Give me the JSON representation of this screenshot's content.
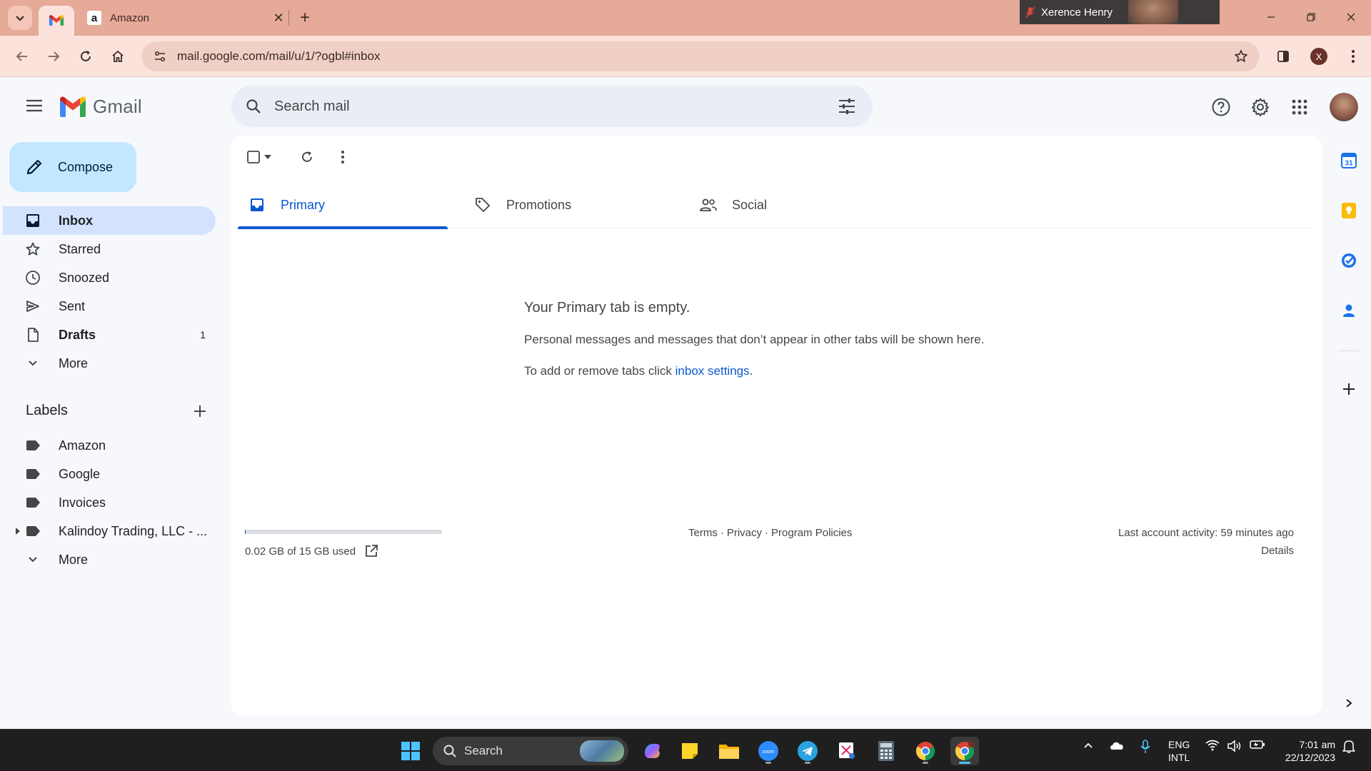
{
  "browser": {
    "tabs": [
      {
        "title": "",
        "favicon": "gmail-icon",
        "active": true
      },
      {
        "title": "Amazon",
        "favicon": "amazon-icon",
        "active": false
      }
    ],
    "video_overlay": {
      "name": "Xerence Henry"
    },
    "url": "mail.google.com/mail/u/1/?ogbl#inbox",
    "profile_initial": "X"
  },
  "gmail": {
    "logo_text": "Gmail",
    "search": {
      "placeholder": "Search mail"
    },
    "compose_label": "Compose",
    "nav": [
      {
        "label": "Inbox",
        "icon": "inbox-icon",
        "active": true,
        "bold": true,
        "count": ""
      },
      {
        "label": "Starred",
        "icon": "star-icon",
        "active": false,
        "bold": false,
        "count": ""
      },
      {
        "label": "Snoozed",
        "icon": "clock-icon",
        "active": false,
        "bold": false,
        "count": ""
      },
      {
        "label": "Sent",
        "icon": "send-icon",
        "active": false,
        "bold": false,
        "count": ""
      },
      {
        "label": "Drafts",
        "icon": "draft-icon",
        "active": false,
        "bold": true,
        "count": "1"
      },
      {
        "label": "More",
        "icon": "chevron-down-icon",
        "active": false,
        "bold": false,
        "count": ""
      }
    ],
    "labels_title": "Labels",
    "labels": [
      {
        "label": "Amazon",
        "expandable": false
      },
      {
        "label": "Google",
        "expandable": false
      },
      {
        "label": "Invoices",
        "expandable": false
      },
      {
        "label": "Kalindoy Trading, LLC - ...",
        "expandable": true
      }
    ],
    "labels_more": "More",
    "category_tabs": [
      {
        "label": "Primary",
        "icon": "inbox-icon",
        "active": true
      },
      {
        "label": "Promotions",
        "icon": "tag-icon",
        "active": false
      },
      {
        "label": "Social",
        "icon": "people-icon",
        "active": false
      }
    ],
    "empty_state": {
      "title": "Your Primary tab is empty.",
      "description": "Personal messages and messages that don’t appear in other tabs will be shown here.",
      "hint_prefix": "To add or remove tabs click ",
      "hint_link": "inbox settings",
      "hint_suffix": "."
    },
    "footer": {
      "storage_text": "0.02 GB of 15 GB used",
      "storage_fraction": 0.0013,
      "links": [
        "Terms",
        "Privacy",
        "Program Policies"
      ],
      "activity": "Last account activity: 59 minutes ago",
      "details": "Details"
    }
  },
  "taskbar": {
    "search_label": "Search",
    "apps": [
      "windows-start-icon",
      "copilot-icon",
      "sticky-notes-icon",
      "file-explorer-icon",
      "zoom-icon",
      "telegram-icon",
      "snipping-tool-icon",
      "calculator-icon",
      "chrome-icon",
      "chrome-profile-icon"
    ],
    "lang_line1": "ENG",
    "lang_line2": "INTL",
    "time": "7:01 am",
    "date": "22/12/2023"
  },
  "colors": {
    "browser_frame": "#e6aa98",
    "compose_bg": "#c2e7ff",
    "active_nav": "#d3e3fd",
    "accent": "#0b57d0"
  }
}
